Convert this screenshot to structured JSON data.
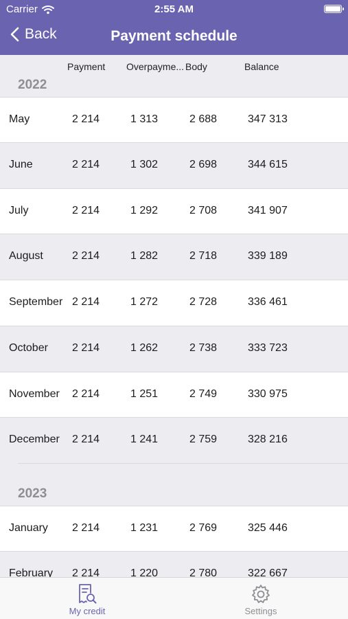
{
  "status_bar": {
    "carrier": "Carrier",
    "time": "2:55 AM"
  },
  "nav": {
    "back_label": "Back",
    "title": "Payment schedule"
  },
  "columns": [
    "Payment",
    "Overpayme...",
    "Body",
    "Balance"
  ],
  "years": [
    {
      "year": "2022",
      "rows": [
        {
          "month": "May",
          "payment": "2 214",
          "overpayment": "1 313",
          "body": "2 688",
          "balance": "347 313"
        },
        {
          "month": "June",
          "payment": "2 214",
          "overpayment": "1 302",
          "body": "2 698",
          "balance": "344 615"
        },
        {
          "month": "July",
          "payment": "2 214",
          "overpayment": "1 292",
          "body": "2 708",
          "balance": "341 907"
        },
        {
          "month": "August",
          "payment": "2 214",
          "overpayment": "1 282",
          "body": "2 718",
          "balance": "339 189"
        },
        {
          "month": "September",
          "payment": "2 214",
          "overpayment": "1 272",
          "body": "2 728",
          "balance": "336 461"
        },
        {
          "month": "October",
          "payment": "2 214",
          "overpayment": "1 262",
          "body": "2 738",
          "balance": "333 723"
        },
        {
          "month": "November",
          "payment": "2 214",
          "overpayment": "1 251",
          "body": "2 749",
          "balance": "330 975"
        },
        {
          "month": "December",
          "payment": "2 214",
          "overpayment": "1 241",
          "body": "2 759",
          "balance": "328 216"
        }
      ]
    },
    {
      "year": "2023",
      "rows": [
        {
          "month": "January",
          "payment": "2 214",
          "overpayment": "1 231",
          "body": "2 769",
          "balance": "325 446"
        },
        {
          "month": "February",
          "payment": "2 214",
          "overpayment": "1 220",
          "body": "2 780",
          "balance": "322 667"
        }
      ]
    }
  ],
  "tabbar": {
    "my_credit": "My credit",
    "settings": "Settings"
  },
  "colors": {
    "accent": "#6a64b0",
    "row_alt": "#ececf1",
    "inactive": "#8e8e93"
  },
  "icons": {
    "back": "chevron-left-icon",
    "my_credit": "receipt-search-icon",
    "settings": "gear-icon",
    "wifi": "wifi-icon",
    "battery": "battery-icon"
  }
}
